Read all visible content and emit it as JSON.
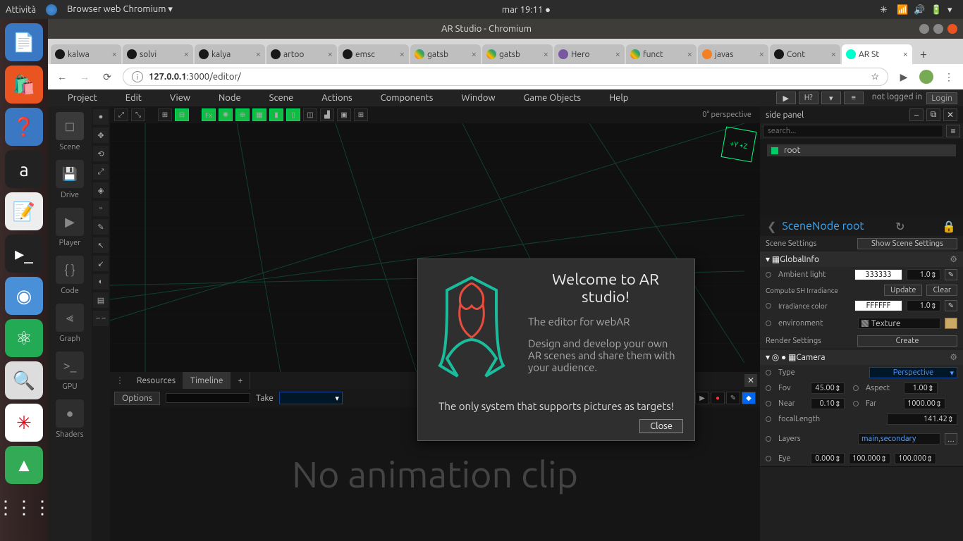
{
  "os": {
    "activities": "Attività",
    "app": "Browser web Chromium ▾",
    "clock": "mar 19:11 ●"
  },
  "chrome": {
    "title": "AR Studio - Chromium",
    "tabs": [
      {
        "label": "kalwa",
        "icon": "gh"
      },
      {
        "label": "solvi",
        "icon": "gh"
      },
      {
        "label": "kalya",
        "icon": "gh"
      },
      {
        "label": "artoo",
        "icon": "gh"
      },
      {
        "label": "emsc",
        "icon": "gh"
      },
      {
        "label": "gatsb",
        "icon": "goog"
      },
      {
        "label": "gatsb",
        "icon": "goog"
      },
      {
        "label": "Hero",
        "icon": "hero"
      },
      {
        "label": "funct",
        "icon": "goog"
      },
      {
        "label": "javas",
        "icon": "so"
      },
      {
        "label": "Cont",
        "icon": "gh"
      },
      {
        "label": "AR St",
        "icon": "ar",
        "active": true
      }
    ],
    "url_prefix": "127.0.0.1",
    "url_suffix": ":3000/editor/"
  },
  "menu": [
    "Project",
    "Edit",
    "View",
    "Node",
    "Scene",
    "Actions",
    "Components",
    "Window",
    "Game Objects",
    "Help"
  ],
  "login": {
    "status": "not logged in",
    "button": "Login"
  },
  "modes": [
    "Scene",
    "Drive",
    "Player",
    "Code",
    "Graph",
    "GPU",
    "Shaders"
  ],
  "vp": {
    "label": "0° perspective",
    "axis": "+Y +Z"
  },
  "bottom": {
    "tabs": [
      "Resources",
      "Timeline",
      "+"
    ],
    "options": "Options",
    "take": "Take",
    "empty": "No animation clip"
  },
  "side": {
    "title": "side panel",
    "search_ph": "search...",
    "root": "root",
    "scenenode": "SceneNode root",
    "scene_settings_label": "Scene Settings",
    "show_settings": "Show Scene Settings",
    "globalinfo": "GlobalInfo",
    "ambient_label": "Ambient light",
    "ambient_hex": "333333",
    "ambient_v": "1.0",
    "sh_label": "Compute SH Irradiance",
    "update": "Update",
    "clear": "Clear",
    "irr_label": "Irradiance color",
    "irr_hex": "FFFFFF",
    "irr_v": "1.0",
    "env_label": "environment",
    "tex": "Texture",
    "render_label": "Render Settings",
    "create": "Create",
    "camera": "Camera",
    "type_label": "Type",
    "type_val": "Perspective",
    "fov_label": "Fov",
    "fov": "45.00",
    "aspect_label": "Aspect",
    "aspect": "1.00",
    "near_label": "Near",
    "near": "0.10",
    "far_label": "Far",
    "far": "1000.00",
    "focal_label": "focalLength",
    "focal": "141.42",
    "layers_label": "Layers",
    "layers": "main,secondary",
    "eye_label": "Eye",
    "eye0": "0.000",
    "eye1": "100.000",
    "eye2": "100.000"
  },
  "modal": {
    "title": "Welcome to AR studio!",
    "subtitle": "The editor for webAR",
    "body": "Design and develop your own AR scenes and share them with your audience.",
    "footer": "The only system that supports pictures as targets!",
    "close": "Close"
  }
}
